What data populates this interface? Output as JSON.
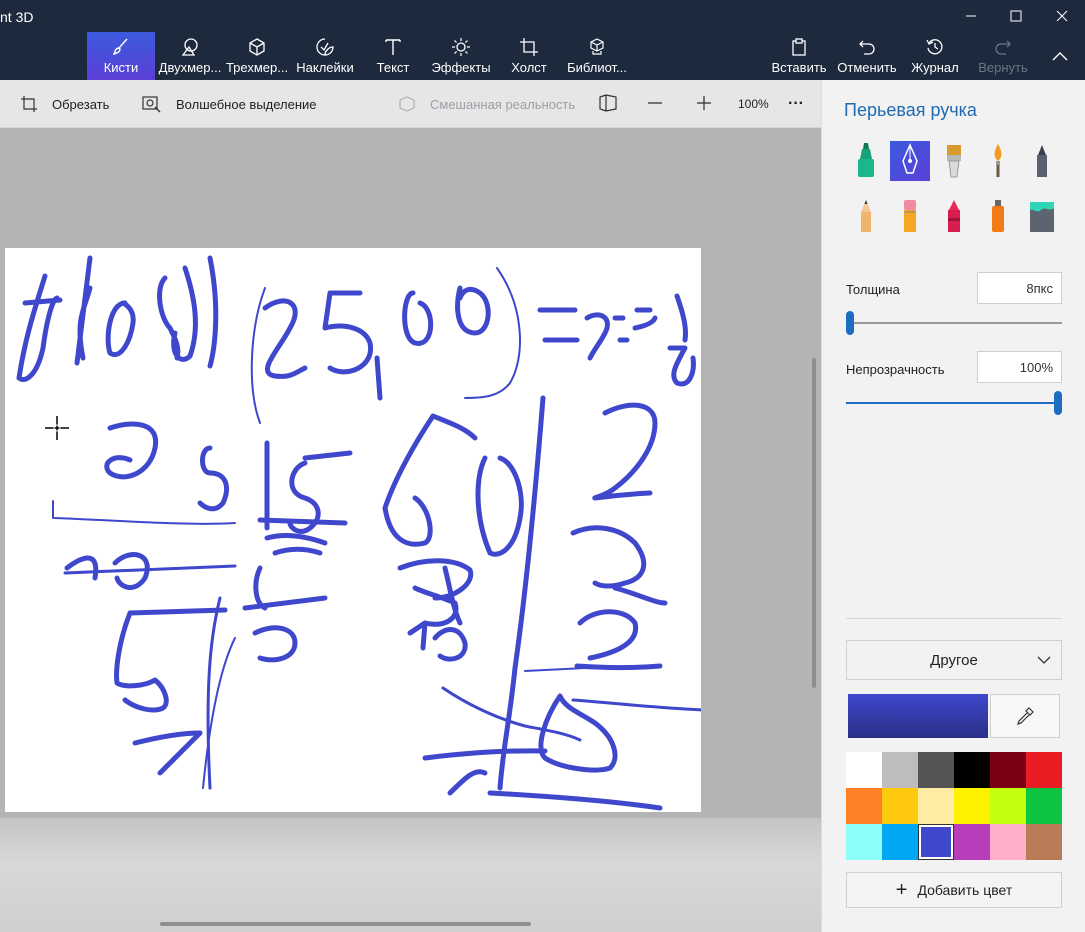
{
  "app": {
    "title": "nt 3D"
  },
  "window_controls": {
    "minimize": "—",
    "maximize": "☐",
    "close": "✕"
  },
  "ribbon": {
    "tabs": [
      {
        "label": "Кисти",
        "icon": "brush-icon",
        "active": true
      },
      {
        "label": "Двухмер...",
        "icon": "2d-shapes-icon"
      },
      {
        "label": "Трехмер...",
        "icon": "3d-shapes-icon"
      },
      {
        "label": "Наклейки",
        "icon": "stickers-icon"
      },
      {
        "label": "Текст",
        "icon": "text-icon"
      },
      {
        "label": "Эффекты",
        "icon": "effects-icon"
      },
      {
        "label": "Холст",
        "icon": "canvas-icon"
      },
      {
        "label": "Библиот...",
        "icon": "library-icon"
      }
    ],
    "actions": [
      {
        "label": "Вставить",
        "icon": "paste-icon"
      },
      {
        "label": "Отменить",
        "icon": "undo-icon"
      },
      {
        "label": "Журнал",
        "icon": "history-icon"
      },
      {
        "label": "Вернуть",
        "icon": "redo-icon",
        "disabled": true
      }
    ],
    "collapse_icon": "chevron-up-icon"
  },
  "toolbar": {
    "crop_label": "Обрезать",
    "magic_select_label": "Волшебное выделение",
    "mixed_reality_label": "Смешанная реальность",
    "zoom_level": "100%",
    "more_label": "···"
  },
  "panel": {
    "title": "Перьевая ручка",
    "brushes": [
      "marker",
      "calligraphy-pen",
      "oil-brush",
      "watercolor",
      "pixel-pen",
      "pencil",
      "eraser",
      "crayon",
      "spray-can",
      "fill"
    ],
    "selected_brush": "calligraphy-pen",
    "thickness_label": "Толщина",
    "thickness_value": "8пкс",
    "thickness_fraction": 0.0,
    "opacity_label": "Непрозрачность",
    "opacity_value": "100%",
    "opacity_fraction": 1.0,
    "palette_dropdown": "Другое",
    "current_color": "#3d47cc",
    "swatches": [
      "#ffffff",
      "#bdbdbd",
      "#545454",
      "#000000",
      "#7b0015",
      "#ec1c24",
      "#ff7f27",
      "#ffc90e",
      "#ffeca3",
      "#fff200",
      "#c4ff0e",
      "#0ec443",
      "#8cfffb",
      "#00a8f3",
      "#3f48cc",
      "#b83dba",
      "#ffaec8",
      "#b97a57"
    ],
    "selected_swatch_index": 14,
    "add_color_label": "Добавить цвет"
  }
}
